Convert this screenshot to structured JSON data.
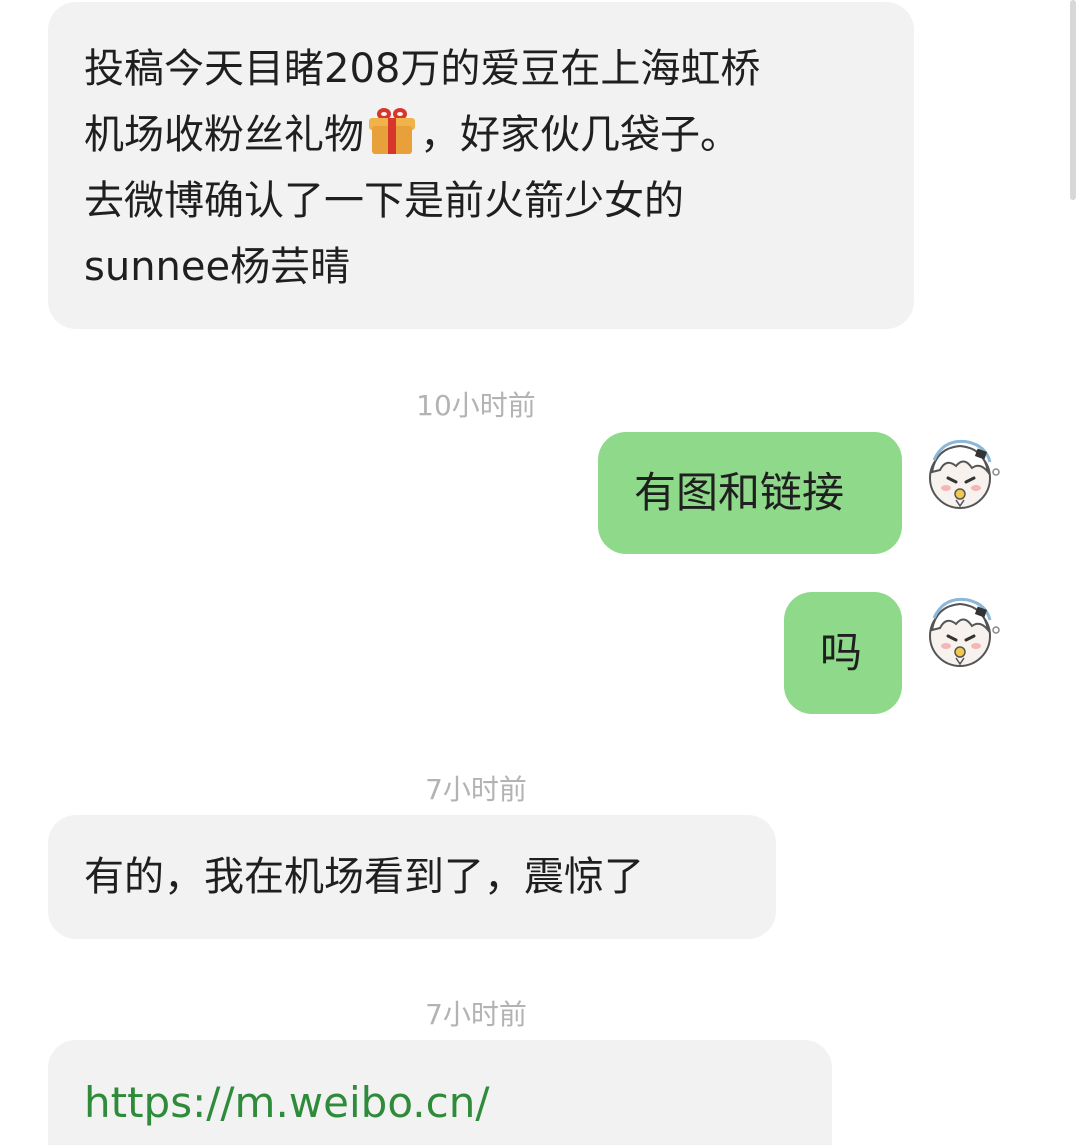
{
  "messages": [
    {
      "side": "incoming",
      "lines": [
        "投稿今天目睹208万的爱豆在上海虹桥",
        "机场收粉丝礼物",
        "，好家伙几袋子。",
        "去微博确认了一下是前火箭少女的",
        "sunnee杨芸晴"
      ],
      "emoji": "gift-icon"
    },
    {
      "timestamp": "10小时前"
    },
    {
      "side": "outgoing",
      "text": "有图和链接"
    },
    {
      "side": "outgoing",
      "text": "吗"
    },
    {
      "timestamp": "7小时前"
    },
    {
      "side": "incoming",
      "text": "有的，我在机场看到了，震惊了"
    },
    {
      "timestamp": "7小时前"
    },
    {
      "side": "incoming",
      "link": "https://m.weibo.cn/"
    }
  ],
  "colors": {
    "incoming_bubble": "#f2f2f2",
    "outgoing_bubble": "#8fd98a",
    "link": "#2e8b3a",
    "timestamp": "#b3b3b3"
  }
}
